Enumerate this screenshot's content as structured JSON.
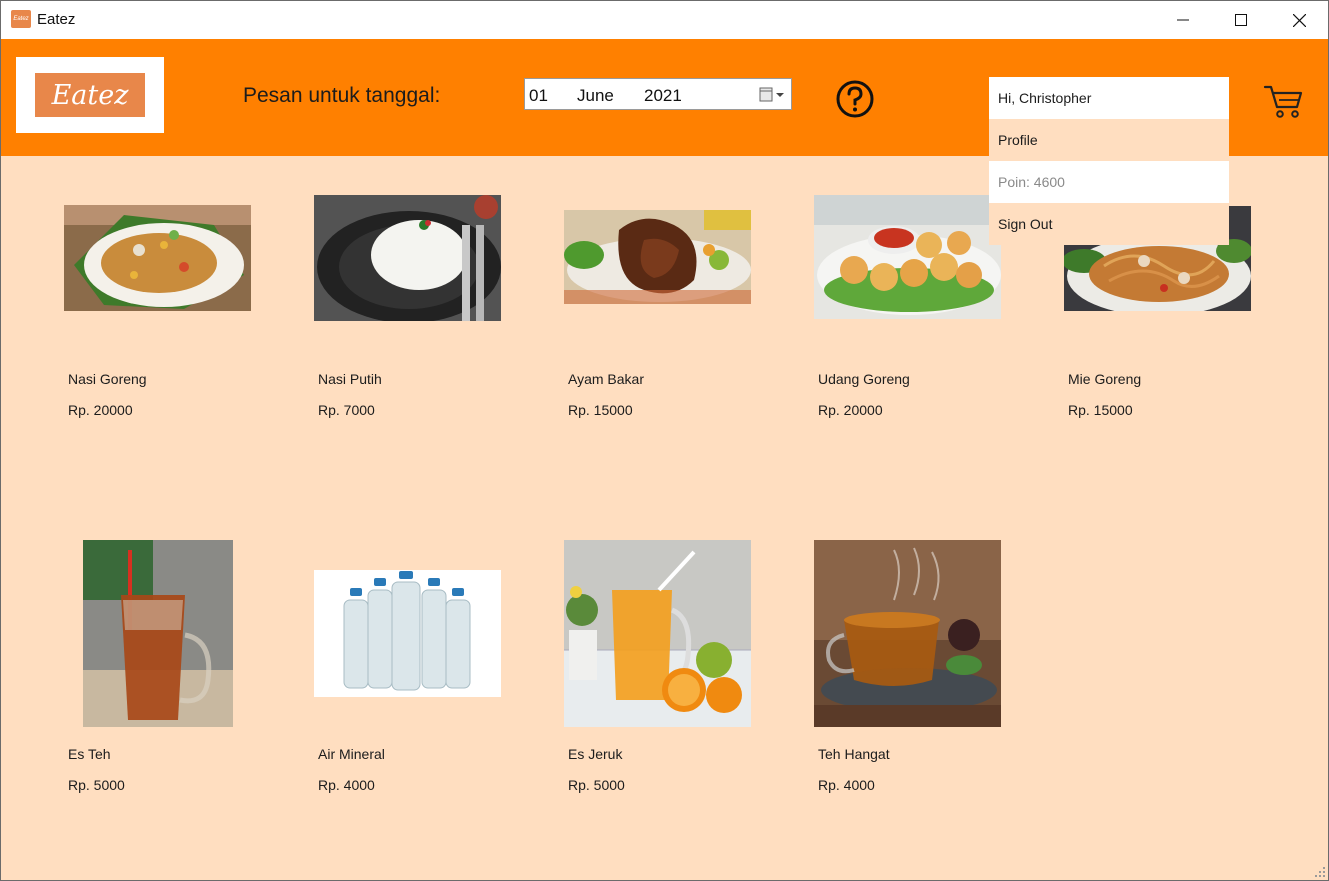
{
  "window": {
    "title": "Eatez",
    "app_icon_text": "Eatez"
  },
  "header": {
    "logo_text": "Eatez",
    "order_label": "Pesan untuk tanggal:",
    "date": {
      "day": "01",
      "month": "June",
      "year": "2021"
    }
  },
  "user_menu": {
    "greeting": "Hi, Christopher",
    "profile": "Profile",
    "points": "Poin: 4600",
    "sign_out": "Sign Out"
  },
  "products": [
    {
      "name": "Nasi Goreng",
      "price": "Rp. 20000"
    },
    {
      "name": "Nasi Putih",
      "price": "Rp. 7000"
    },
    {
      "name": "Ayam Bakar",
      "price": "Rp. 15000"
    },
    {
      "name": "Udang Goreng",
      "price": "Rp. 20000"
    },
    {
      "name": "Mie Goreng",
      "price": "Rp. 15000"
    },
    {
      "name": "Es Teh",
      "price": "Rp. 5000"
    },
    {
      "name": "Air Mineral",
      "price": "Rp. 4000"
    },
    {
      "name": "Es Jeruk",
      "price": "Rp. 5000"
    },
    {
      "name": "Teh Hangat",
      "price": "Rp. 4000"
    }
  ],
  "colors": {
    "header": "#FF8000",
    "background": "#FFDEC0",
    "logo": "#E8874A"
  }
}
